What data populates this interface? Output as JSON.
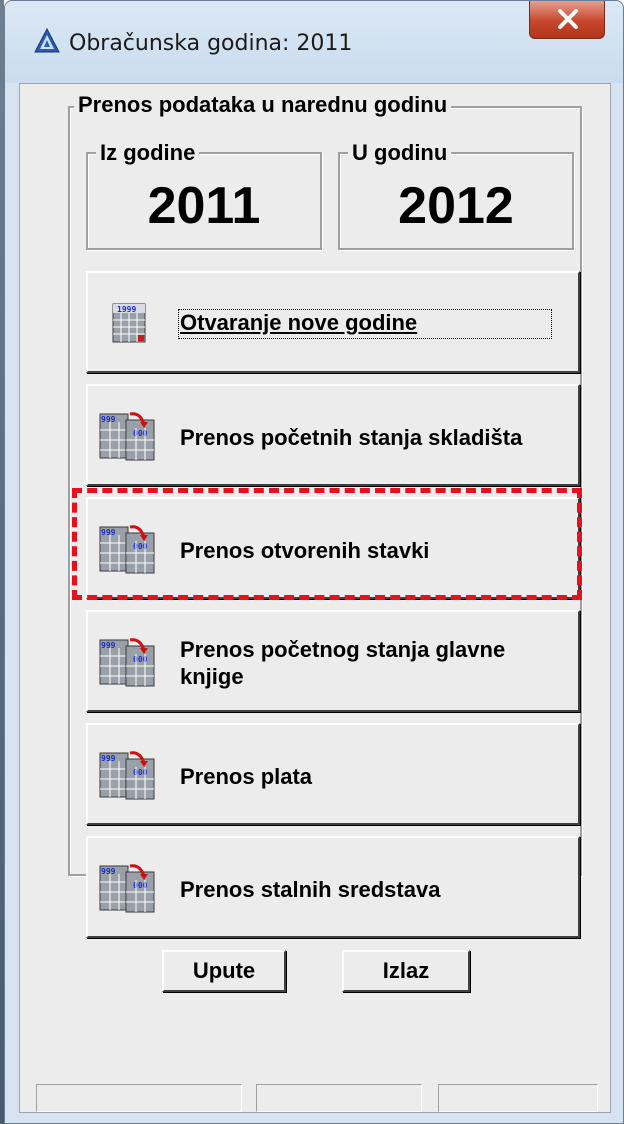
{
  "window": {
    "title": "Obračunska godina: 2011",
    "close_label": "x"
  },
  "transfer_group": {
    "label": "Prenos podataka u narednu godinu",
    "from": {
      "label": "Iz godine",
      "value": "2011"
    },
    "to": {
      "label": "U godinu",
      "value": "2012"
    }
  },
  "actions": [
    {
      "label": "Otvaranje nove godine",
      "icon": "calendar-icon"
    },
    {
      "label": "Prenos početnih stanja skladišta",
      "icon": "transfer-calendar-icon"
    },
    {
      "label": "Prenos otvorenih stavki",
      "icon": "transfer-calendar-icon"
    },
    {
      "label": "Prenos početnog stanja glavne knjige",
      "icon": "transfer-calendar-icon"
    },
    {
      "label": "Prenos plata",
      "icon": "transfer-calendar-icon"
    },
    {
      "label": "Prenos stalnih sredstava",
      "icon": "transfer-calendar-icon"
    }
  ],
  "footer": {
    "help_label": "Upute",
    "exit_label": "Izlaz"
  },
  "colors": {
    "highlight": "#e8101c",
    "dialog_face": "#ececec",
    "titlebar": "#d7e3f1"
  }
}
